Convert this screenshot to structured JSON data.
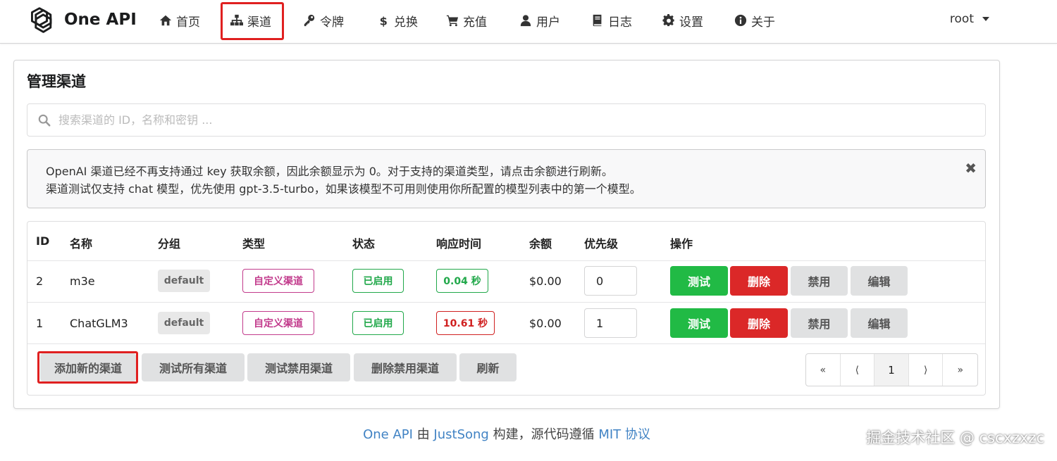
{
  "brand": "One API",
  "nav": [
    {
      "label": "首页"
    },
    {
      "label": "渠道"
    },
    {
      "label": "令牌"
    },
    {
      "label": "兑换"
    },
    {
      "label": "充值"
    },
    {
      "label": "用户"
    },
    {
      "label": "日志"
    },
    {
      "label": "设置"
    },
    {
      "label": "关于"
    }
  ],
  "user": "root",
  "page": {
    "title": "管理渠道",
    "search_placeholder": "搜索渠道的 ID，名称和密钥 ...",
    "message_line1": "OpenAI 渠道已经不再支持通过 key 获取余额，因此余额显示为 0。对于支持的渠道类型，请点击余额进行刷新。",
    "message_line2": "渠道测试仅支持 chat 模型，优先使用 gpt-3.5-turbo，如果该模型不可用则使用你所配置的模型列表中的第一个模型。",
    "close_glyph": "✖"
  },
  "table": {
    "headers": [
      "ID",
      "名称",
      "分组",
      "类型",
      "状态",
      "响应时间",
      "余额",
      "优先级",
      "操作"
    ],
    "rows": [
      {
        "id": "2",
        "name": "m3e",
        "group": "default",
        "type": "自定义渠道",
        "status": "已启用",
        "response": "0.04 秒",
        "balance": "$0.00",
        "priority": "0"
      },
      {
        "id": "1",
        "name": "ChatGLM3",
        "group": "default",
        "type": "自定义渠道",
        "status": "已启用",
        "response": "10.61 秒",
        "balance": "$0.00",
        "priority": "1"
      }
    ],
    "actions": {
      "test": "测试",
      "delete": "删除",
      "disable": "禁用",
      "edit": "编辑"
    }
  },
  "footer_buttons": {
    "add": "添加新的渠道",
    "test_all": "测试所有渠道",
    "test_disabled": "测试禁用渠道",
    "delete_disabled": "删除禁用渠道",
    "refresh": "刷新"
  },
  "pagination": {
    "first": "«",
    "prev": "⟨",
    "current": "1",
    "next": "⟩",
    "last": "»"
  },
  "footer": {
    "link1": "One API",
    "text1": " 由 ",
    "link2": "JustSong",
    "text2": " 构建，源代码遵循 ",
    "link3": "MIT 协议"
  },
  "watermark": "掘金技术社区 @ cscxzxzc",
  "colors": {
    "success": "#21ba45",
    "danger": "#db2828",
    "link": "#4183c4",
    "type_label": "#c23b8c",
    "highlight_box": "#e02020"
  }
}
